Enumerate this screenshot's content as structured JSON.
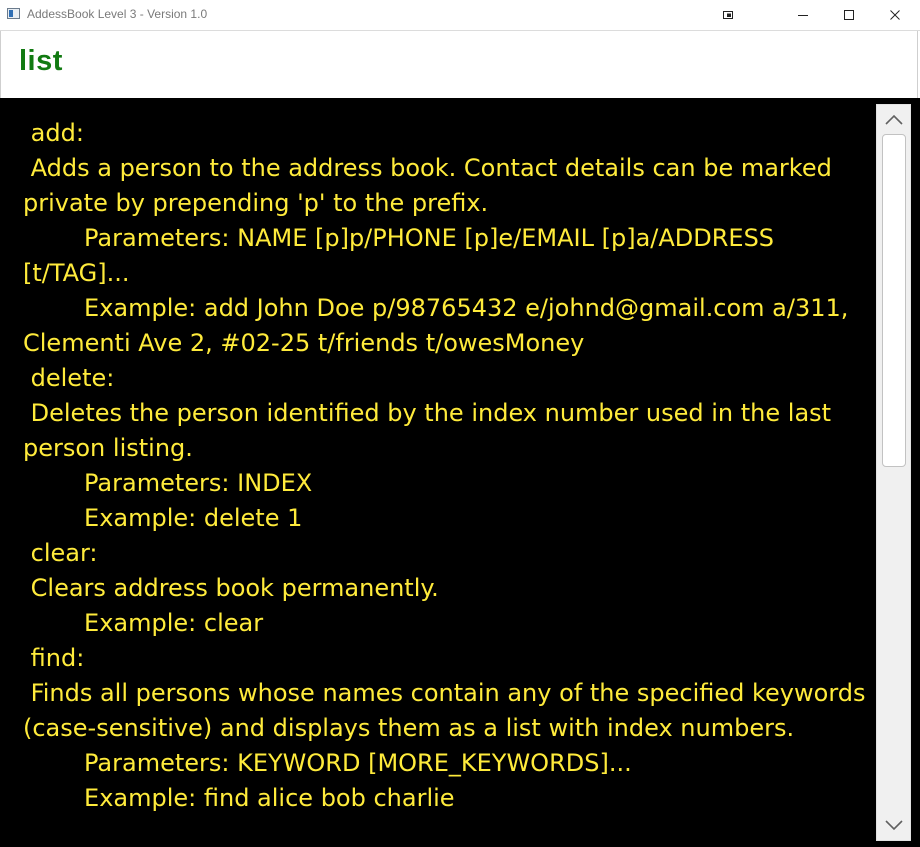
{
  "window": {
    "title": "AddessBook Level 3 - Version 1.0",
    "icons": [
      "app-icon",
      "restore-overlay-icon",
      "minimize-icon",
      "maximize-icon",
      "close-icon"
    ]
  },
  "command_box": {
    "value": "list",
    "text_color": "#117a11"
  },
  "result_display": {
    "text_color": "#ffeb3b",
    "background": "#000000",
    "text": " add:\n Adds a person to the address book. Contact details can be marked private by prepending 'p' to the prefix.\n\tParameters: NAME [p]p/PHONE [p]e/EMAIL [p]a/ADDRESS [t/TAG]...\n\tExample: add John Doe p/98765432 e/johnd@gmail.com a/311, Clementi Ave 2, #02-25 t/friends t/owesMoney\n delete:\n Deletes the person identified by the index number used in the last person listing.\n\tParameters: INDEX\n\tExample: delete 1\n clear:\n Clears address book permanently.\n\tExample: clear\n find:\n Finds all persons whose names contain any of the specified keywords (case-sensitive) and displays them as a list with index numbers.\n\tParameters: KEYWORD [MORE_KEYWORDS]...\n\tExample: find alice bob charlie"
  },
  "scrollbar": {
    "icons": [
      "chevron-up-icon",
      "chevron-down-icon"
    ]
  }
}
